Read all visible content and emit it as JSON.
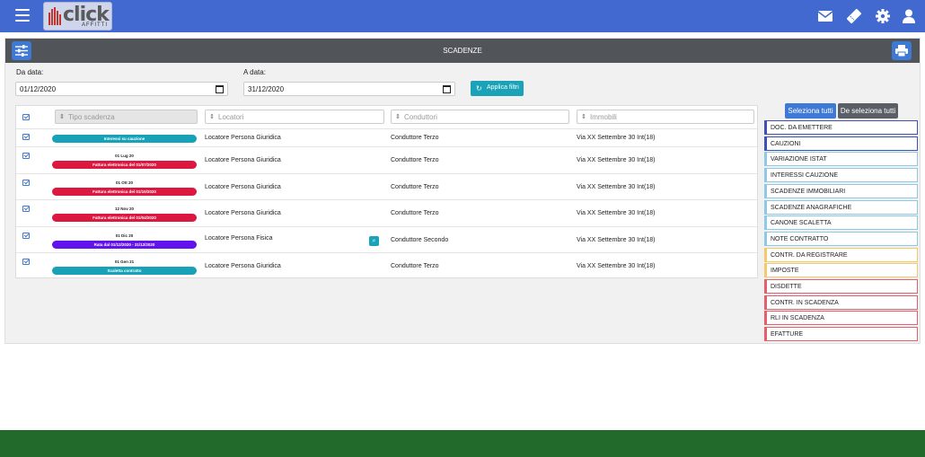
{
  "topbar": {
    "logo_word": "click",
    "logo_sub": "AFFITTI",
    "icons": [
      "menu-icon",
      "envelope-icon",
      "ticket-icon",
      "gear-icon",
      "user-icon"
    ]
  },
  "panel": {
    "title": "SCADENZE"
  },
  "filters": {
    "from_label": "Da data:",
    "from_value": "01/12/2020",
    "to_label": "A data:",
    "to_value": "31/12/2020",
    "apply_label": "Applica filtri"
  },
  "table": {
    "placeholders": [
      "Tipo scadenza",
      "Locatori",
      "Conduttori",
      "Immobili"
    ],
    "rows": [
      {
        "date": "",
        "pill": "Interessi su cauzione",
        "pill_color": "#17a2b8",
        "locatore": "Locatore Persona Giuridica",
        "conduttore": "Conduttore Terzo",
        "immobile": "Via XX Settembre 30 Int(18)",
        "zoom": false
      },
      {
        "date": "01 Lug 20",
        "pill": "Fattura elettronica del 01/07/2020",
        "pill_color": "#dc1740",
        "locatore": "Locatore Persona Giuridica",
        "conduttore": "Conduttore Terzo",
        "immobile": "Via XX Settembre 30 Int(18)",
        "zoom": false
      },
      {
        "date": "01 Ott 20",
        "pill": "Fattura elettronica del 01/10/2020",
        "pill_color": "#dc1740",
        "locatore": "Locatore Persona Giuridica",
        "conduttore": "Conduttore Terzo",
        "immobile": "Via XX Settembre 30 Int(18)",
        "zoom": false
      },
      {
        "date": "12 Nov 20",
        "pill": "Fattura elettronica del 01/04/2020",
        "pill_color": "#dc1740",
        "locatore": "Locatore Persona Giuridica",
        "conduttore": "Conduttore Terzo",
        "immobile": "Via XX Settembre 30 Int(18)",
        "zoom": false
      },
      {
        "date": "01 Dic 20",
        "pill": "Rata dal 01/12/2020 - 31/12/2020",
        "pill_color": "#6212ec",
        "locatore": "Locatore Persona Fisica",
        "conduttore": "Conduttore Secondo",
        "immobile": "Via XX Settembre 30 Int(18)",
        "zoom": true
      },
      {
        "date": "01 Gen 21",
        "pill": "Scaletta contratto",
        "pill_color": "#17a2b8",
        "locatore": "Locatore Persona Giuridica",
        "conduttore": "Conduttore Terzo",
        "immobile": "Via XX Settembre 30 Int(18)",
        "zoom": false
      }
    ]
  },
  "categories": {
    "select_all": "Seleziona tutti",
    "deselect_all": "De seleziona tutti",
    "items": [
      {
        "label": "DOC. DA EMETTERE",
        "color": "#3f51b5"
      },
      {
        "label": "CAUZIONI",
        "color": "#3f51b5"
      },
      {
        "label": "VARIAZIONE ISTAT",
        "color": "#8ecae6"
      },
      {
        "label": "INTERESSI CAUZIONE",
        "color": "#8ecae6"
      },
      {
        "label": "SCADENZE IMMOBILIARI",
        "color": "#8ecae6"
      },
      {
        "label": "SCADENZE ANAGRAFICHE",
        "color": "#8ecae6"
      },
      {
        "label": "CANONE SCALETTA",
        "color": "#8ecae6"
      },
      {
        "label": "NOTE CONTRATTO",
        "color": "#8ecae6"
      },
      {
        "label": "CONTR. DA REGISTRARE",
        "color": "#f3c969"
      },
      {
        "label": "IMPOSTE",
        "color": "#f3c969"
      },
      {
        "label": "DISDETTE",
        "color": "#e4606d"
      },
      {
        "label": "CONTR. IN SCADENZA",
        "color": "#e4606d"
      },
      {
        "label": "RLI IN SCADENZA",
        "color": "#e4606d"
      },
      {
        "label": "EFATTURE",
        "color": "#e4606d"
      }
    ]
  },
  "colors": {
    "topbar": "#4169cf",
    "panel_header": "#51555a",
    "primary": "#3f79d6",
    "info": "#19a2b8",
    "footer": "#216a2c"
  }
}
